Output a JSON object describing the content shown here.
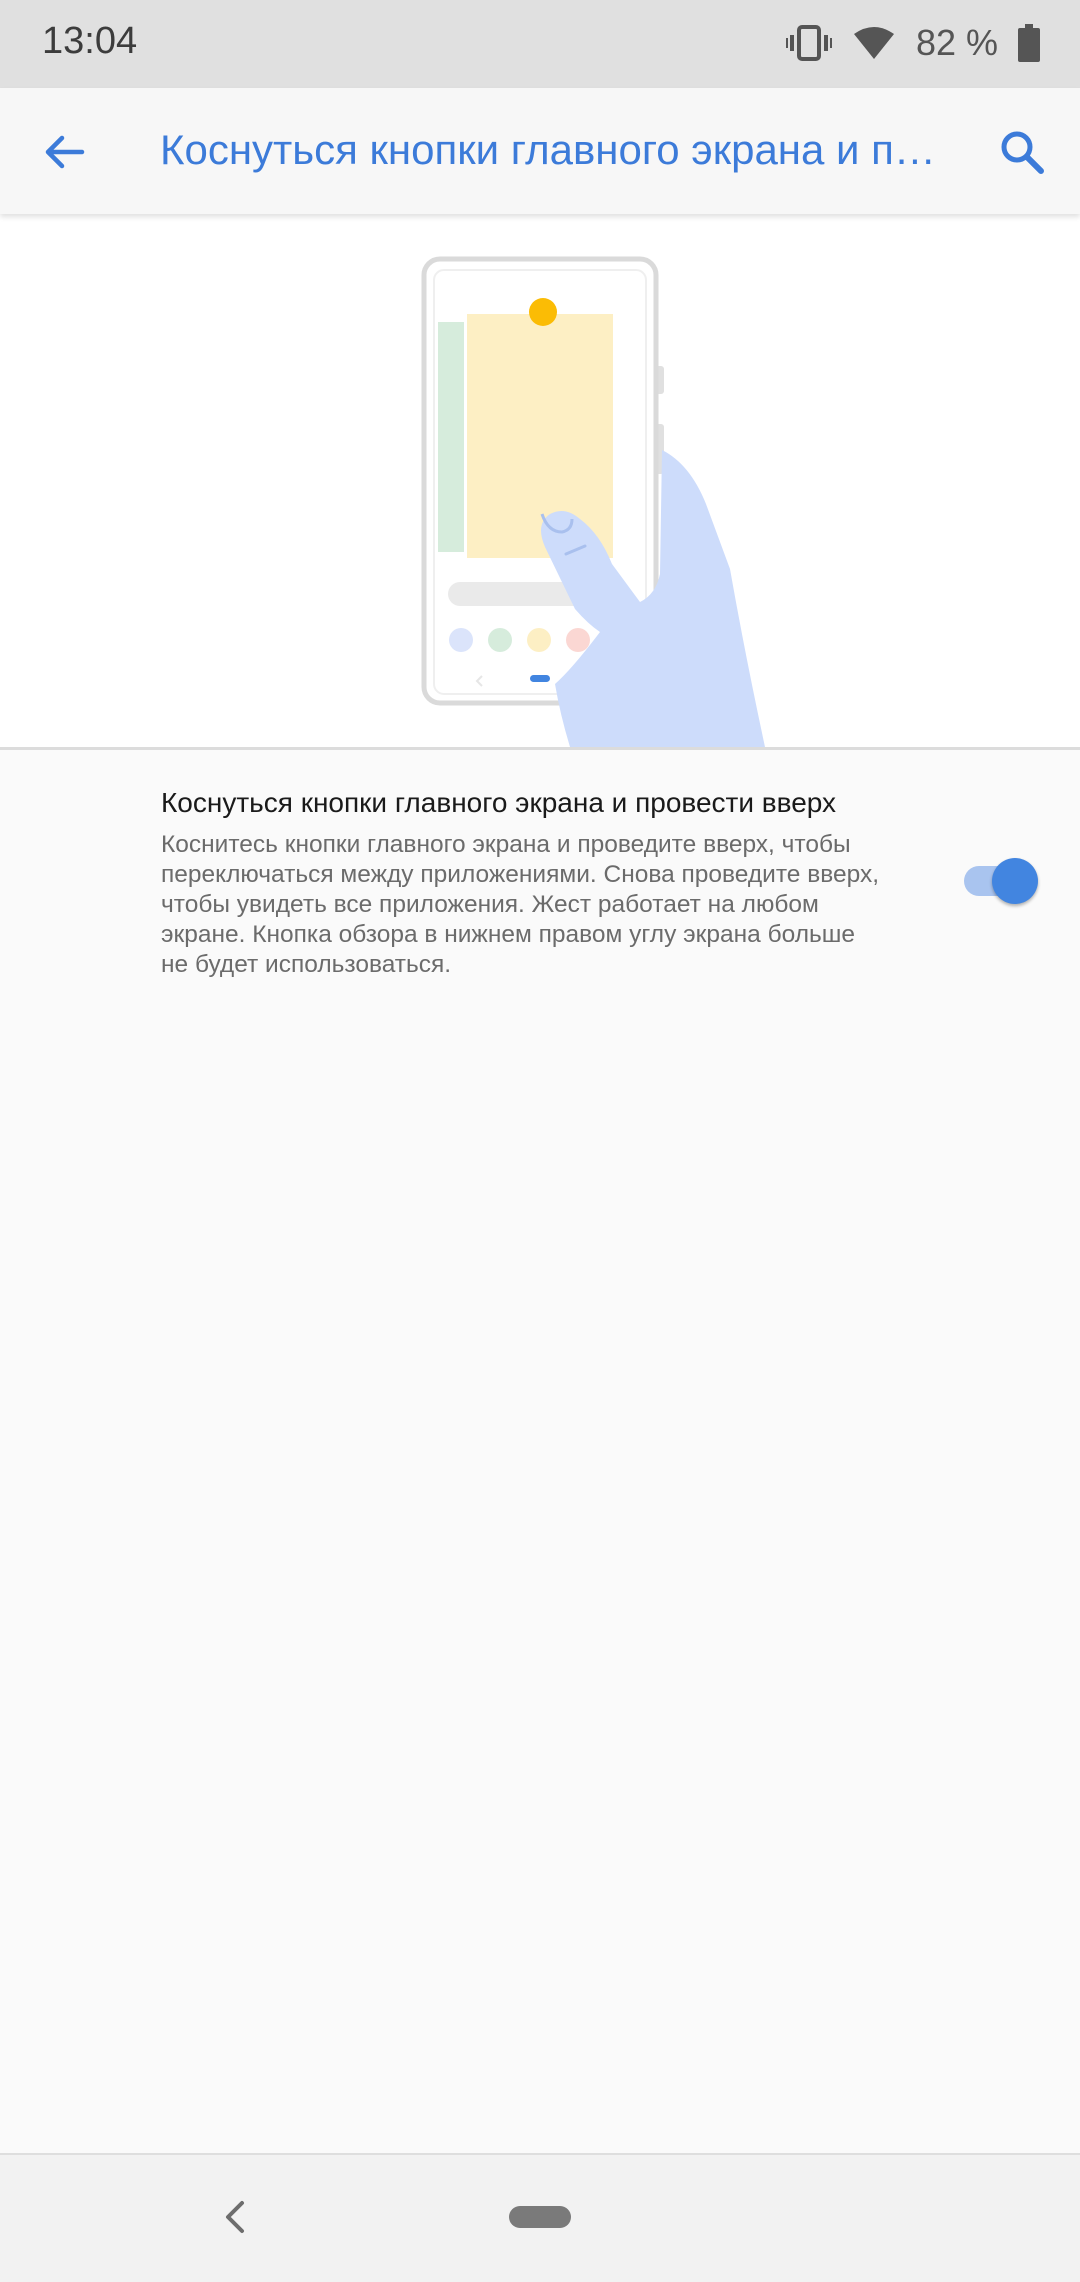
{
  "status_bar": {
    "time": "13:04",
    "battery_text": "82 %",
    "icons": [
      "vibrate-icon",
      "wifi-icon",
      "battery-icon"
    ]
  },
  "app_bar": {
    "title": "Коснуться кнопки главного экрана и провести вверх",
    "back_icon": "arrow-back-icon",
    "search_icon": "search-icon"
  },
  "setting": {
    "title": "Коснуться кнопки главного экрана и провести вверх",
    "summary": "Коснитесь кнопки главного экрана и проведите вверх, чтобы переключаться между приложениями. Снова проведите вверх, чтобы увидеть все приложения. Жест работает на любом экране. Кнопка обзора в нижнем правом углу экрана больше не будет использоваться.",
    "enabled": true
  },
  "colors": {
    "accent": "#4285e0",
    "title_blue": "#3c7bd9",
    "hand": "#cddcfb",
    "card_yellow": "#fdefc4",
    "card_green": "#d6ecdc",
    "dot_yellow": "#fbbc05"
  },
  "nav_bar": {
    "icons": [
      "nav-back-icon",
      "nav-home-pill-icon"
    ]
  }
}
